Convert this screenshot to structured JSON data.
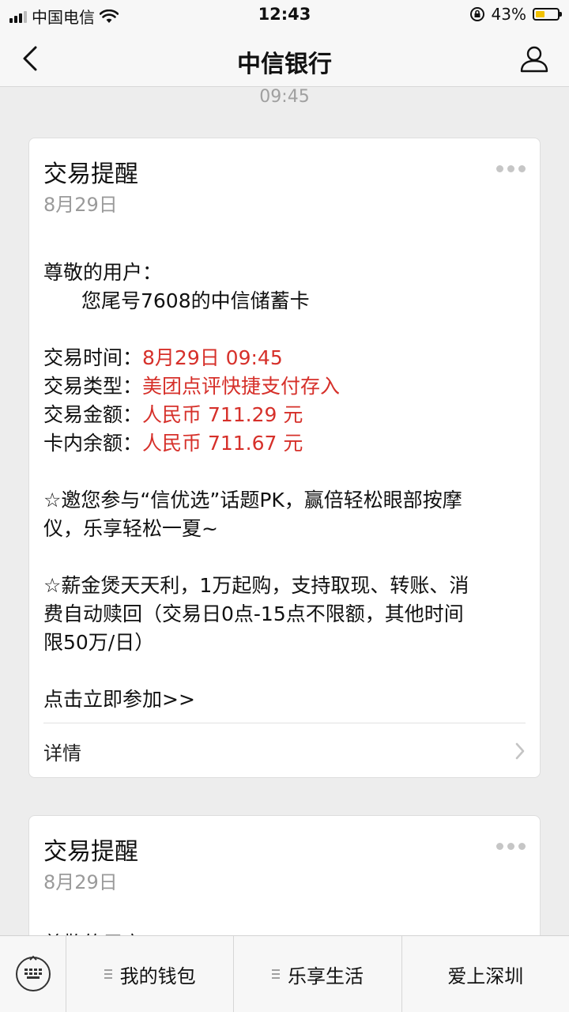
{
  "status_bar": {
    "carrier": "中国电信",
    "time": "12:43",
    "battery_percent": "43%",
    "battery_level": 0.43
  },
  "nav": {
    "title": "中信银行"
  },
  "timestamp": "09:45",
  "cards": [
    {
      "title": "交易提醒",
      "date": "8月29日",
      "greeting": "尊敬的用户：",
      "intro": "您尾号7608的中信储蓄卡",
      "fields": [
        {
          "label": "交易时间：",
          "value": "8月29日 09:45"
        },
        {
          "label": "交易类型：",
          "value": "美团点评快捷支付存入"
        },
        {
          "label": "交易金额：",
          "value": "人民币 711.29 元"
        },
        {
          "label": "卡内余额：",
          "value": "人民币 711.67 元"
        }
      ],
      "promo_1_line_1": "☆邀您参与“信优选”话题PK，赢倍轻松眼部按摩",
      "promo_1_line_2": "仪，乐享轻松一夏~",
      "promo_2_line_1": "☆薪金煲天天利，1万起购，支持取现、转账、消",
      "promo_2_line_2": "费自动赎回（交易日0点-15点不限额，其他时间",
      "promo_2_line_3": "限50万/日）",
      "cta": "点击立即参加>>",
      "details_label": "详情"
    },
    {
      "title": "交易提醒",
      "date": "8月29日",
      "greeting": "尊敬的用户："
    }
  ],
  "menu": {
    "items": [
      {
        "label": "我的钱包"
      },
      {
        "label": "乐享生活"
      },
      {
        "label": "爱上深圳"
      }
    ]
  },
  "colors": {
    "accent_red": "#d6302a",
    "background": "#ededed",
    "battery_yellow": "#f2c200"
  }
}
